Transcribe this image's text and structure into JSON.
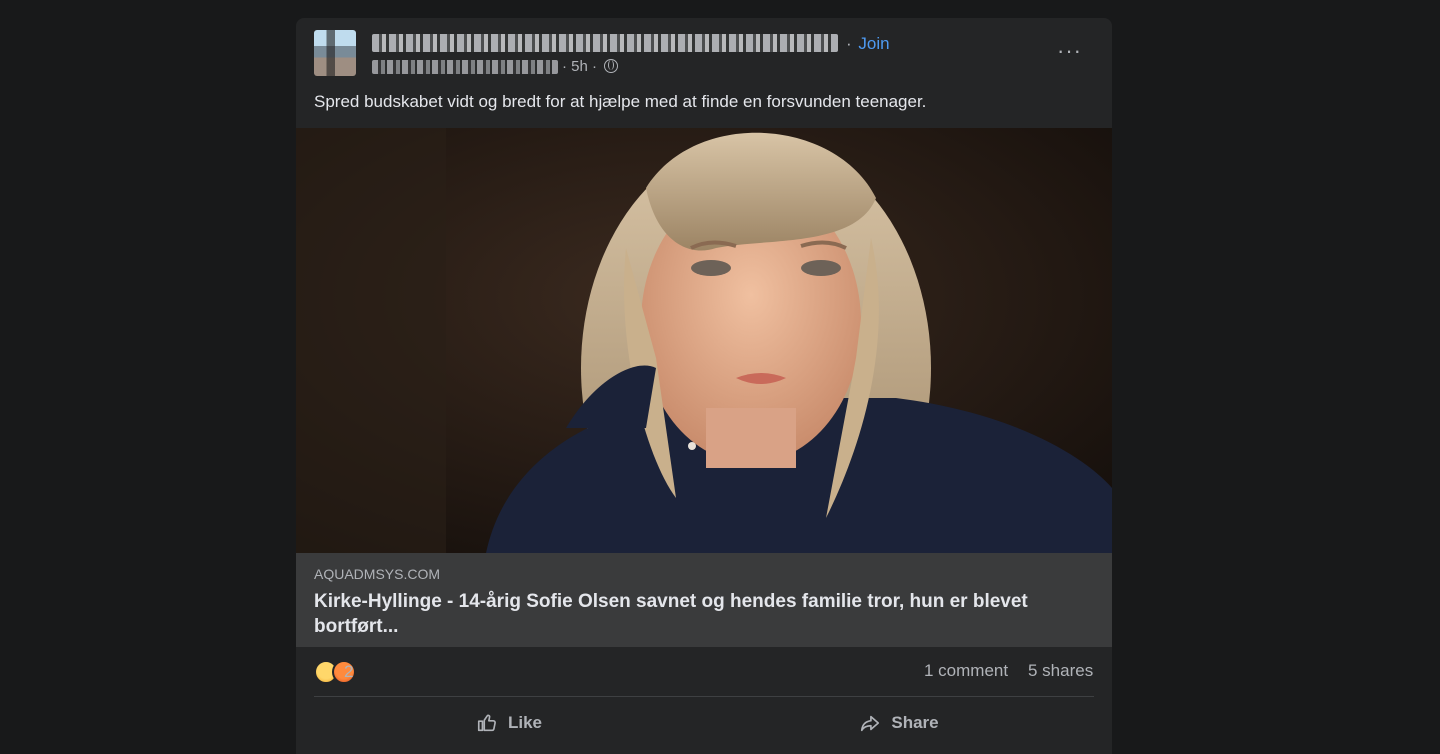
{
  "post": {
    "group_join_separator": "·",
    "join_label": "Join",
    "time": "5h",
    "separator": "·",
    "body": "Spred budskabet vidt og bredt for at hjælpe med at finde en forsvunden teenager.",
    "more_label": "···",
    "icons": [
      "globe-icon",
      "more-icon",
      "like-icon",
      "share-icon"
    ]
  },
  "link_preview": {
    "domain": "AQUADMSYS.COM",
    "headline": "Kirke-Hyllinge - 14-årig Sofie Olsen savnet og hendes familie tror, hun er blevet bortført..."
  },
  "stats": {
    "reaction_count": "2",
    "comments": "1 comment",
    "shares": "5 shares"
  },
  "actions": {
    "like": "Like",
    "share": "Share"
  },
  "colors": {
    "page_bg": "#18191a",
    "card_bg": "#242526",
    "link_bar_bg": "#3a3b3c",
    "link_blue": "#4e9af1",
    "text_primary": "#e4e6eb",
    "text_secondary": "#b0b3b8"
  }
}
